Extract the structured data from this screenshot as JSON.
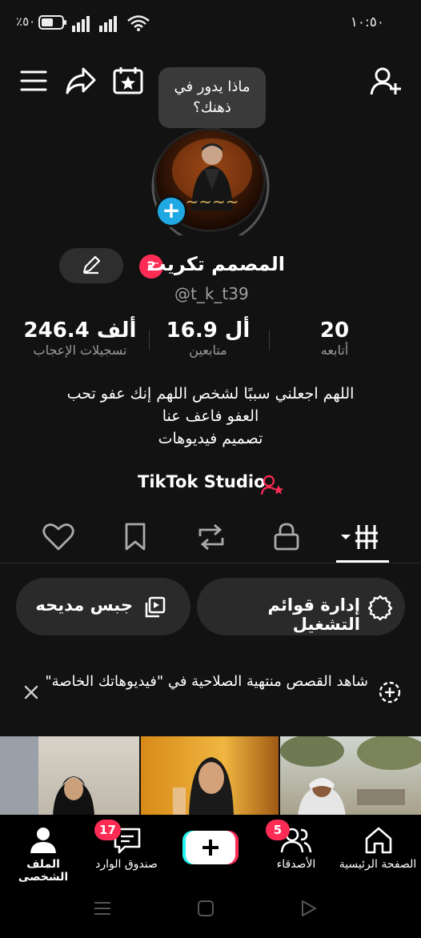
{
  "status_bar": {
    "time": "١٠:٥٠",
    "battery_pct": "٪٥٠"
  },
  "bubble": {
    "line1": "ماذا يدور في",
    "line2": "ذهنك؟"
  },
  "profile": {
    "name": "المصمم تكريت",
    "handle": "@t_k_t39",
    "notification_count": "2"
  },
  "stats": {
    "likes": {
      "value": "246.4 ألف",
      "label": "تسجيلات الإعجاب"
    },
    "followers": {
      "value": "16.9 أل",
      "label": "متابعين"
    },
    "following": {
      "value": "20",
      "label": "أتابعه"
    }
  },
  "bio": {
    "line1": "اللهم اجعلني سببًا لشخص اللهم إنك عفو تحب",
    "line2": "العفو فاعف عنا",
    "line3": "تصميم فيديوهات"
  },
  "studio_link": "TikTok Studio",
  "actions": {
    "playlist": "إدارة قوائم التشغيل",
    "other": "جبس مديحه"
  },
  "banner": {
    "text": "شاهد القصص منتهية الصلاحية في \"فيديوهاتك الخاصة\""
  },
  "bottom_nav": {
    "home": "الصفحة الرئيسية",
    "friends": "الأصدقاء",
    "friends_badge": "5",
    "inbox": "صندوق الوارد",
    "inbox_badge": "17",
    "profile": "الملف الشخصي"
  },
  "colors": {
    "accent": "#fe2c55",
    "plus_badge": "#20a8e3",
    "background": "#121212"
  }
}
